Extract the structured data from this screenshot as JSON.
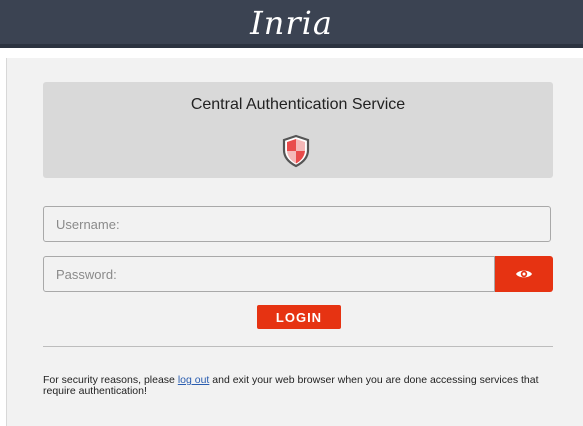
{
  "header": {
    "logo_text": "Inria"
  },
  "cas": {
    "title": "Central Authentication Service",
    "icon": "shield-icon"
  },
  "form": {
    "username_placeholder": "Username:",
    "password_placeholder": "Password:",
    "reveal_icon": "eye-icon",
    "login_label": "LOGIN"
  },
  "notice": {
    "before": "For security reasons, please ",
    "link": "log out",
    "after": " and exit your web browser when you are done accessing services that require authentication!"
  },
  "colors": {
    "topbar": "#3b4352",
    "accent": "#e63312",
    "panel": "#f2f2f2",
    "header_box": "#d9d9d9"
  }
}
